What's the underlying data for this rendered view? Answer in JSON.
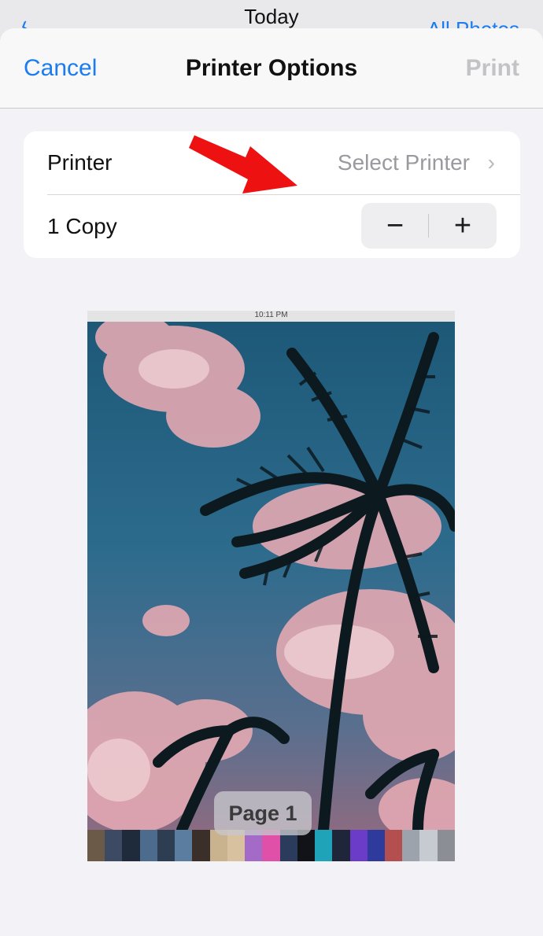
{
  "background": {
    "title": "Today",
    "right_link": "All Photos"
  },
  "navbar": {
    "cancel_label": "Cancel",
    "title": "Printer Options",
    "print_label": "Print"
  },
  "options": {
    "printer_label": "Printer",
    "printer_value": "Select Printer",
    "copies_label": "1 Copy",
    "minus_symbol": "−",
    "plus_symbol": "+"
  },
  "preview": {
    "status_time": "10:11 PM",
    "page_label": "Page 1"
  },
  "colors": {
    "accent": "#1a7cf0",
    "arrow": "#ee1111"
  }
}
